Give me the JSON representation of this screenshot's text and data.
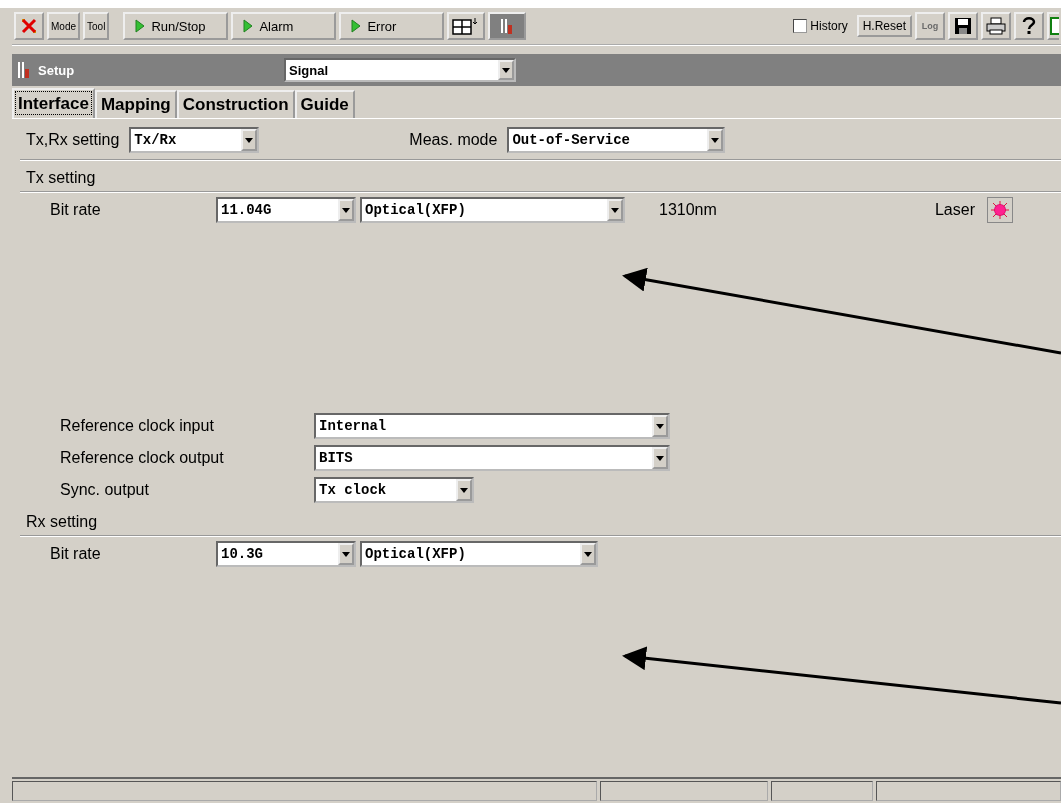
{
  "toolbar": {
    "mode_buttons": [
      "Mode",
      "Tool"
    ],
    "run_buttons": [
      "Run/Stop",
      "Alarm",
      "Error"
    ],
    "history": {
      "label": "History",
      "checked": false
    },
    "reset_button": "H.Reset",
    "log_button": {
      "label": "Log",
      "disabled": true
    }
  },
  "setup_bar": {
    "title": "Setup",
    "selector": "Signal"
  },
  "tabs": [
    {
      "label": "Interface",
      "selected": true
    },
    {
      "label": "Mapping",
      "selected": false
    },
    {
      "label": "Construction",
      "selected": false
    },
    {
      "label": "Guide",
      "selected": false
    }
  ],
  "top_row": [
    {
      "label": "Tx,Rx setting",
      "value": "Tx/Rx"
    },
    {
      "label": "Meas. mode",
      "value": "Out-of-Service"
    }
  ],
  "tx": {
    "title": "Tx setting",
    "bit_rate_label": "Bit rate",
    "bit_rate": "11.04G",
    "interface": "Optical(XFP)",
    "wavelength": "1310nm",
    "laser_label": "Laser",
    "laser_on": true,
    "clock_fields": [
      {
        "label": "Reference clock input",
        "value": "Internal",
        "kind": "wide"
      },
      {
        "label": "Reference clock output",
        "value": "BITS",
        "kind": "wide"
      },
      {
        "label": "Sync. output",
        "value": "Tx clock",
        "kind": "narrow"
      }
    ]
  },
  "rx": {
    "title": "Rx setting",
    "bit_rate_label": "Bit rate",
    "bit_rate": "10.3G",
    "interface": "Optical(XFP)"
  }
}
